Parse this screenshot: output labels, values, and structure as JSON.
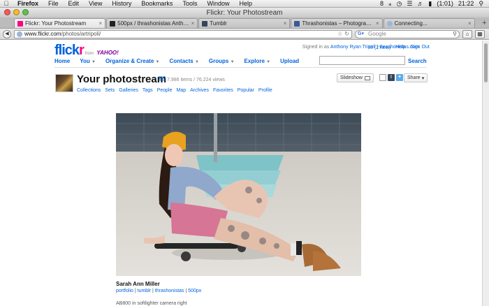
{
  "menubar": {
    "app": "Firefox",
    "items": [
      "File",
      "Edit",
      "View",
      "History",
      "Bookmarks",
      "Tools",
      "Window",
      "Help"
    ],
    "battery": "(1:01)",
    "clock": "21:22",
    "badge": "8"
  },
  "window": {
    "title": "Flickr: Your Photostream"
  },
  "tabs": [
    {
      "title": "Flickr: Your Photostream",
      "color": "#ff0084",
      "active": true
    },
    {
      "title": "500px / thrashonistas Anthony...",
      "color": "#222222",
      "active": false
    },
    {
      "title": "Tumblr",
      "color": "#35465c",
      "active": false
    },
    {
      "title": "Thrashonistas – Photography",
      "color": "#3b5998",
      "active": false
    },
    {
      "title": "Connecting...",
      "color": "#9bb7d8",
      "active": false
    }
  ],
  "navbar": {
    "url_host": "www.flickr.com",
    "url_path": "/photos/artripoli/",
    "search_placeholder": "Google"
  },
  "header": {
    "logo_main": "flick",
    "logo_r": "r",
    "logo_from": "from",
    "logo_yahoo": "YAHOO!",
    "signed_prefix": "Signed in as",
    "signed_user": "Anthony Ryan Tripoli",
    "signed_sep": "|",
    "signed_site": "thrashonistas.com",
    "mail_count": "(2 new)",
    "help": "Help",
    "sign_out": "Sign Out",
    "search_button": "Search"
  },
  "mainnav": [
    "Home",
    "You",
    "Organize & Create",
    "Contacts",
    "Groups",
    "Explore",
    "Upload"
  ],
  "photostream": {
    "title": "Your photostream",
    "pro": "pro",
    "counts": "7,986 items / 76,224 views",
    "slideshow": "Slideshow",
    "share": "Share",
    "subnav": [
      "Collections",
      "Sets",
      "Galleries",
      "Tags",
      "People",
      "Map",
      "Archives",
      "Favorites",
      "Popular",
      "Profile"
    ]
  },
  "photo": {
    "title": "Sarah Ann Miller",
    "links": [
      "portfolio",
      "tumblr",
      "thrashonistas",
      "500px"
    ],
    "link_sep": " | ",
    "description": "AB800 in softlighter camera right"
  }
}
